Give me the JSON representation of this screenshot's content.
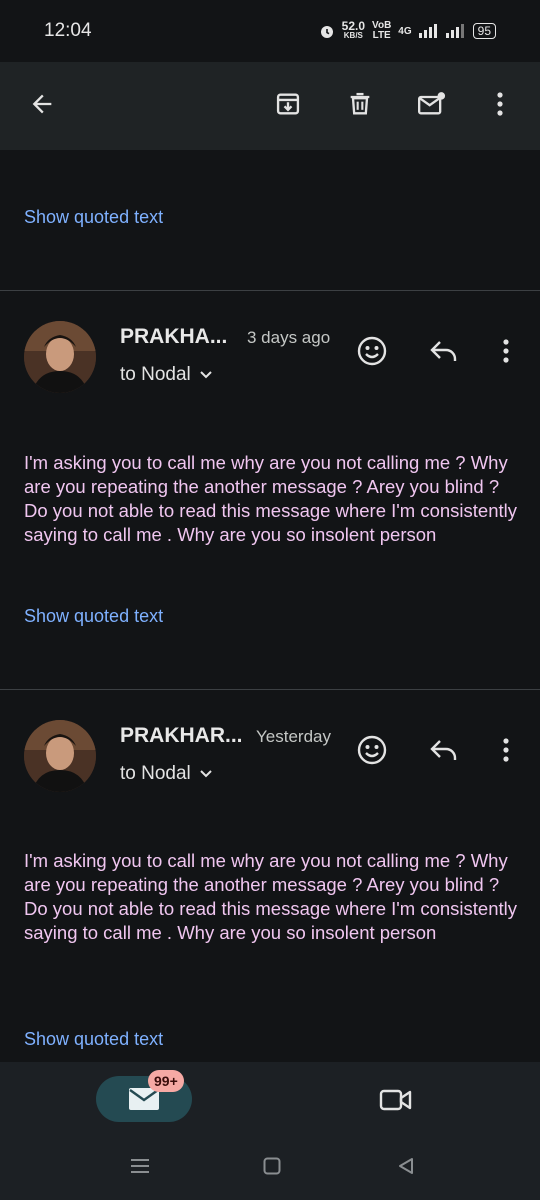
{
  "status_bar": {
    "time": "12:04",
    "speed_value": "52.0",
    "speed_unit": "KB/S",
    "carrier_top": "VoB",
    "carrier_bottom": "LTE",
    "network": "4G",
    "battery": "95"
  },
  "app_bar": {
    "icons": [
      "back-arrow-icon",
      "archive-icon",
      "delete-icon",
      "mark-unread-icon",
      "more-vert-icon"
    ]
  },
  "thread": {
    "show_quoted_text": "Show quoted text",
    "messages": [
      {
        "sender": "PRAKHA...",
        "time": "3 days ago",
        "to": "to Nodal",
        "body": "I'm asking you to call me why are you not calling me ? Why are you repeating the another message ? Arey you blind ? Do you not able to read this message where I'm consistently saying to call me . Why are you so insolent person",
        "show_quoted_text": "Show quoted text"
      },
      {
        "sender": "PRAKHAR...",
        "time": "Yesterday",
        "to": "to Nodal",
        "body": "I'm asking you to call me why are you not calling me ? Why are you repeating the another message ? Arey you blind ? Do you not able to read this message where I'm consistently saying to call me . Why are you so insolent person",
        "show_quoted_text": "Show quoted text"
      }
    ]
  },
  "bottom_nav": {
    "mail_badge": "99+",
    "items": [
      "mail-icon",
      "video-icon"
    ]
  },
  "colors": {
    "background": "#121416",
    "link": "#7fb1ff",
    "body_text": "#f0c6f0",
    "badge": "#f6a9a4"
  }
}
